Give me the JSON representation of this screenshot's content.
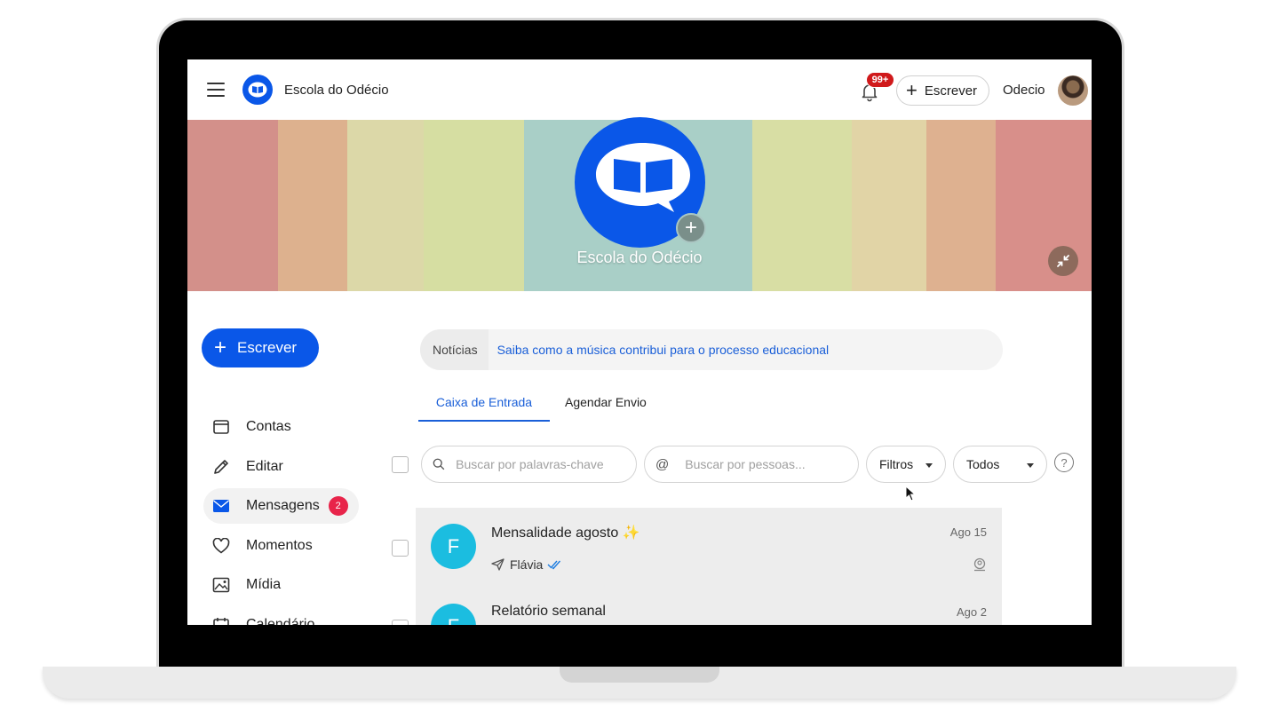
{
  "header": {
    "school_name": "Escola do Odécio",
    "notification_count": "99+",
    "compose_label": "Escrever",
    "user_name": "Odecio"
  },
  "banner": {
    "title": "Escola do Odécio",
    "stripe_colors": [
      "#d3908a",
      "#ddb18e",
      "#dcd8a8",
      "#d6dea2",
      "#a9cfc7",
      "#d8dea4",
      "#e1d4a6",
      "#deb190",
      "#d88f8a"
    ]
  },
  "sidebar": {
    "compose_label": "Escrever",
    "items": [
      {
        "label": "Contas",
        "icon": "wallet-icon"
      },
      {
        "label": "Editar",
        "icon": "pencil-icon"
      },
      {
        "label": "Mensagens",
        "icon": "envelope-icon",
        "badge": "2",
        "active": true
      },
      {
        "label": "Momentos",
        "icon": "heart-icon"
      },
      {
        "label": "Mídia",
        "icon": "image-icon"
      },
      {
        "label": "Calendário",
        "icon": "calendar-icon"
      }
    ]
  },
  "news": {
    "label": "Notícias",
    "link_text": "Saiba como a música contribui para o processo educacional"
  },
  "tabs": [
    {
      "label": "Caixa de Entrada",
      "active": true
    },
    {
      "label": "Agendar Envio",
      "active": false
    }
  ],
  "filters": {
    "keyword_placeholder": "Buscar por palavras-chave",
    "people_placeholder": "Buscar por pessoas...",
    "filter_label": "Filtros",
    "scope_label": "Todos",
    "help_symbol": "?"
  },
  "messages": [
    {
      "initial": "F",
      "subject": "Mensalidade agosto",
      "emoji": "✨",
      "sender": "Flávia",
      "date": "Ago 15"
    },
    {
      "initial": "F",
      "subject": "Relatório semanal",
      "emoji": "",
      "sender": "",
      "date": "Ago 2"
    }
  ],
  "colors": {
    "brand_blue": "#0a57e8",
    "link_blue": "#1a5fd8",
    "avatar_cyan": "#1bbde0",
    "badge_red": "#e8244a"
  }
}
